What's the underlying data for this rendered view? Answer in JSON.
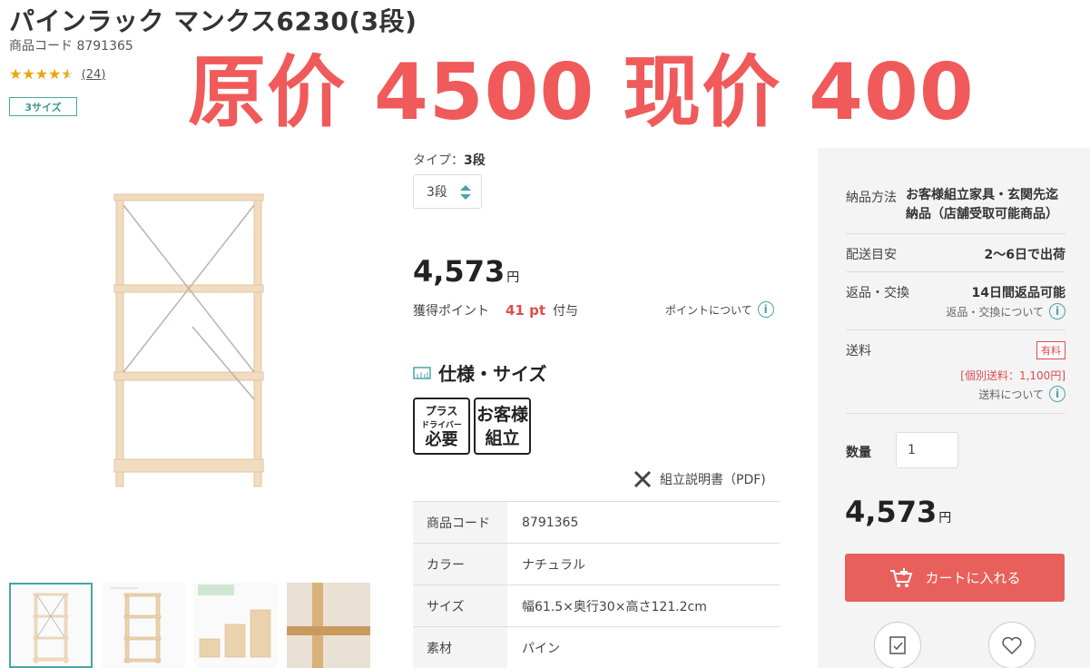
{
  "product": {
    "title": "パインラック マンクス6230(3段)",
    "code_label": "商品コード",
    "code": "8791365",
    "rating": 4.5,
    "review_count": "(24)",
    "size_badge": "3サイズ"
  },
  "overlay_text": "原价 4500 现价 400",
  "options": {
    "type_label": "タイプ：",
    "type_value": "3段",
    "select_value": "3段"
  },
  "pricing": {
    "price": "4,573",
    "yen": "円",
    "points_label": "獲得ポイント",
    "points_value": "41 pt",
    "points_suffix": "付与",
    "points_about": "ポイントについて"
  },
  "spec": {
    "heading": "仕様・サイズ",
    "badge1_l1": "プラス",
    "badge1_l2": "ドライバー",
    "badge1_l3": "必要",
    "badge2_l1": "お客様",
    "badge2_l2": "組立",
    "pdf_link": "組立説明書（PDF)",
    "rows": [
      {
        "k": "商品コード",
        "v": "8791365"
      },
      {
        "k": "カラー",
        "v": "ナチュラル"
      },
      {
        "k": "サイズ",
        "v": "幅61.5×奥行30×高さ121.2cm"
      },
      {
        "k": "素材",
        "v": "パイン"
      }
    ]
  },
  "panel": {
    "delivery_method_label": "納品方法",
    "delivery_method_value": "お客様組立家具・玄関先迄納品（店舗受取可能商品）",
    "shipping_eta_label": "配送目安",
    "shipping_eta_value": "2〜6日で出荷",
    "return_label": "返品・交換",
    "return_value": "14日間返品可能",
    "return_about": "返品・交換について",
    "shipping_fee_label": "送料",
    "shipping_fee_badge": "有料",
    "shipping_fee_detail": "[個別送料：1,100円]",
    "shipping_fee_about": "送料について",
    "qty_label": "数量",
    "qty_value": "1",
    "cart_button": "カートに入れる"
  },
  "colors": {
    "accent": "#4aa5a3",
    "overlay": "#f05a5a",
    "cart": "#e8605c",
    "point": "#e04c4c"
  }
}
